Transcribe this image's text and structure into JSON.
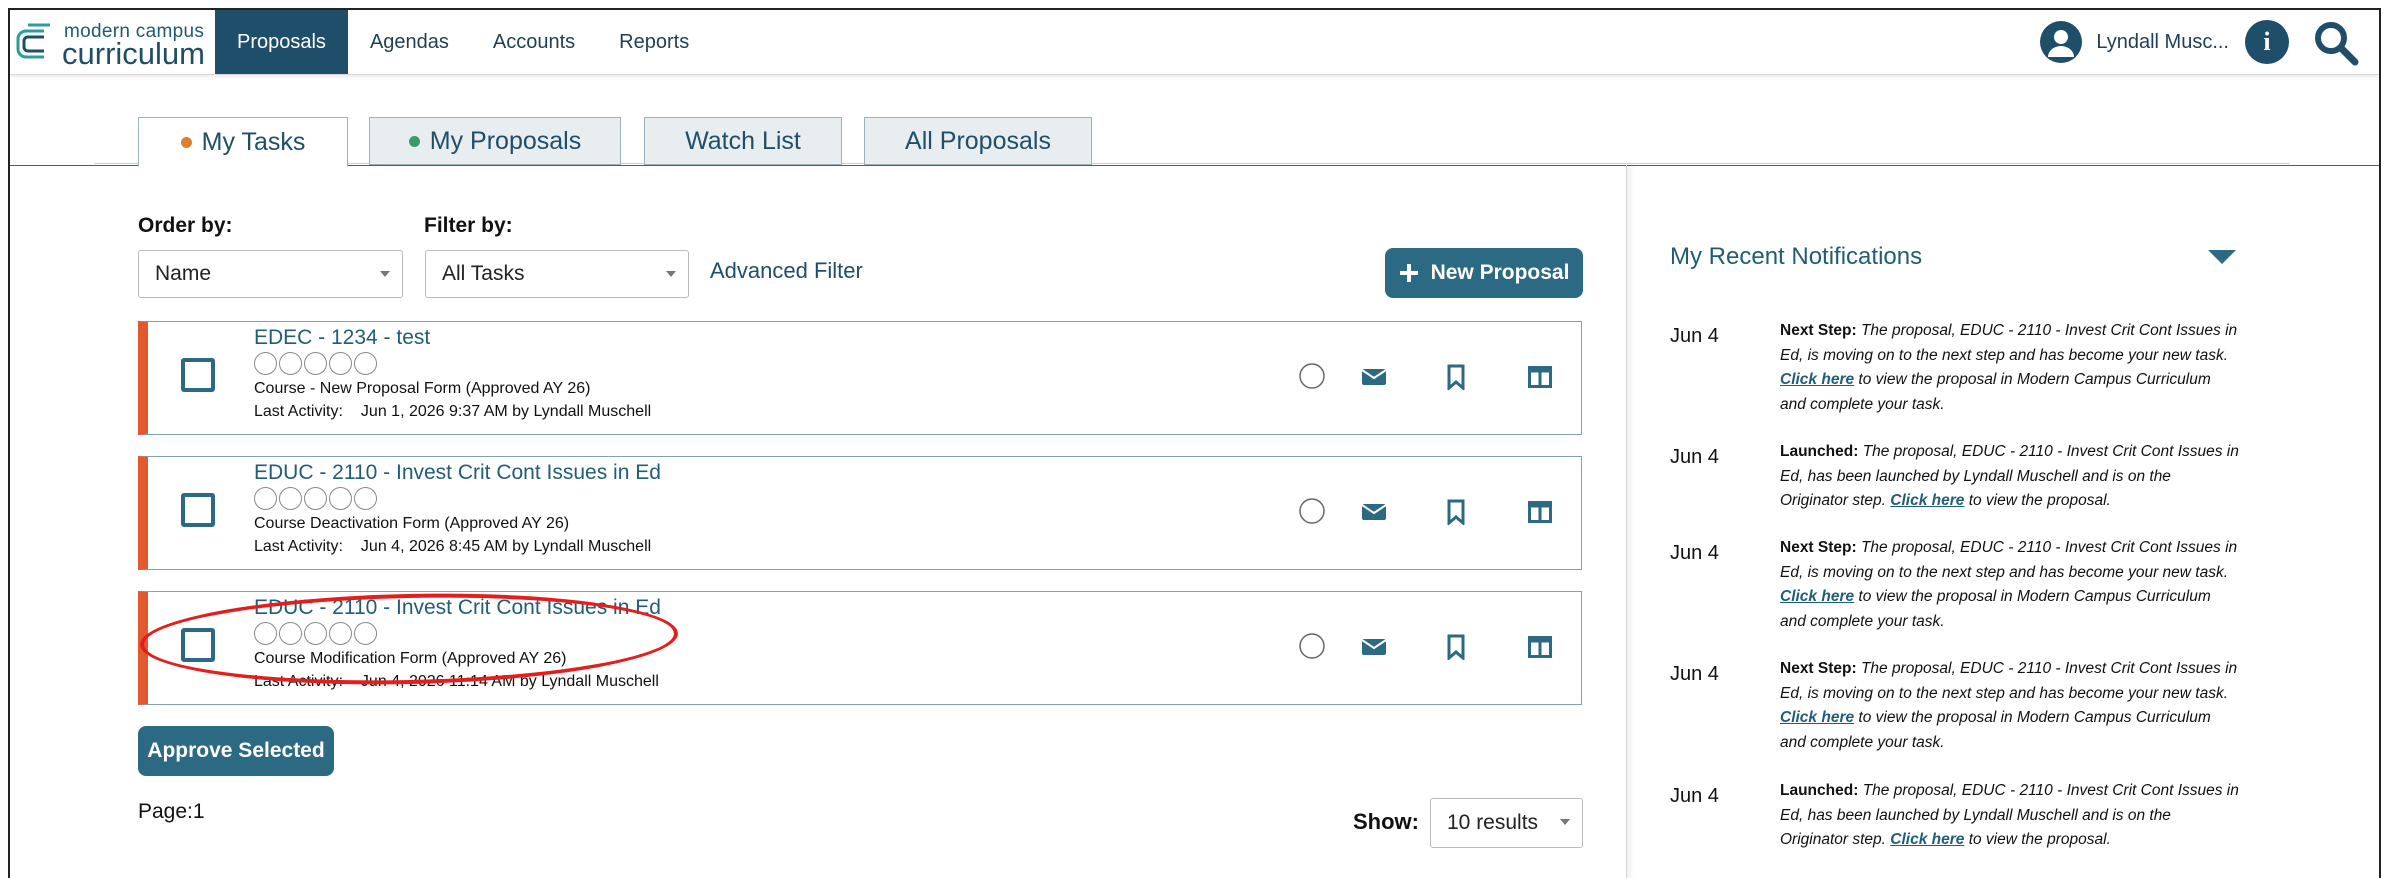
{
  "app": {
    "logo_top": "modern campus",
    "logo_bottom": "curriculum"
  },
  "nav": {
    "items": [
      "Proposals",
      "Agendas",
      "Accounts",
      "Reports"
    ],
    "user_name": "Lyndall Musc...",
    "info_icon": "info-icon",
    "search_icon": "search-icon"
  },
  "tabs": [
    {
      "label": "My Tasks",
      "dot_color": "#d9822b"
    },
    {
      "label": "My Proposals",
      "dot_color": "#3a9b6b"
    },
    {
      "label": "Watch List"
    },
    {
      "label": "All Proposals"
    }
  ],
  "filters": {
    "order_label": "Order by:",
    "order_value": "Name",
    "filter_label": "Filter by:",
    "filter_value": "All Tasks",
    "advanced": "Advanced Filter",
    "new_proposal": "New Proposal"
  },
  "tasks": [
    {
      "title": "EDEC - 1234 - test",
      "form": "Course - New Proposal Form (Approved AY 26)",
      "activity_label": "Last Activity:",
      "activity": "Jun 1, 2026 9:37 AM by Lyndall Muschell"
    },
    {
      "title": "EDUC - 2110 - Invest Crit Cont Issues in Ed",
      "form": "Course Deactivation Form (Approved AY 26)",
      "activity_label": "Last Activity:",
      "activity": "Jun 4, 2026 8:45 AM by Lyndall Muschell"
    },
    {
      "title": "EDUC - 2110 - Invest Crit Cont Issues in Ed",
      "form": "Course Modification Form (Approved AY 26)",
      "activity_label": "Last Activity:",
      "activity": "Jun 4, 2026 11:14 AM by Lyndall Muschell"
    }
  ],
  "footer": {
    "approve": "Approve Selected",
    "page": "Page:1",
    "show_label": "Show:",
    "show_value": "10 results"
  },
  "notifications": {
    "title": "My Recent Notifications",
    "items": [
      {
        "date": "Jun 4",
        "kind": "Next Step:",
        "pre": "The proposal, EDUC - 2110 - Invest Crit Cont Issues in Ed, is moving on to the next step and has become your new task.",
        "link": "Click here",
        "post": "to view the proposal in Modern Campus Curriculum and complete your task."
      },
      {
        "date": "Jun 4",
        "kind": "Launched:",
        "pre": "The proposal, EDUC - 2110 - Invest Crit Cont Issues in Ed, has been launched by Lyndall Muschell and is on the Originator step.",
        "link": "Click here",
        "post": "to view the proposal."
      },
      {
        "date": "Jun 4",
        "kind": "Next Step:",
        "pre": "The proposal, EDUC - 2110 - Invest Crit Cont Issues in Ed, is moving on to the next step and has become your new task.",
        "link": "Click here",
        "post": "to view the proposal in Modern Campus Curriculum and complete your task."
      },
      {
        "date": "Jun 4",
        "kind": "Next Step:",
        "pre": "The proposal, EDUC - 2110 - Invest Crit Cont Issues in Ed, is moving on to the next step and has become your new task.",
        "link": "Click here",
        "post": "to view the proposal in Modern Campus Curriculum and complete your task."
      },
      {
        "date": "Jun 4",
        "kind": "Launched:",
        "pre": "The proposal, EDUC - 2110 - Invest Crit Cont Issues in Ed, has been launched by Lyndall Muschell and is on the Originator step.",
        "link": "Click here",
        "post": "to view the proposal."
      }
    ]
  },
  "colors": {
    "brand": "#1f4e6a",
    "accent": "#2b6a82",
    "row_marker": "#e3582c",
    "annotation": "#e41d1d"
  }
}
